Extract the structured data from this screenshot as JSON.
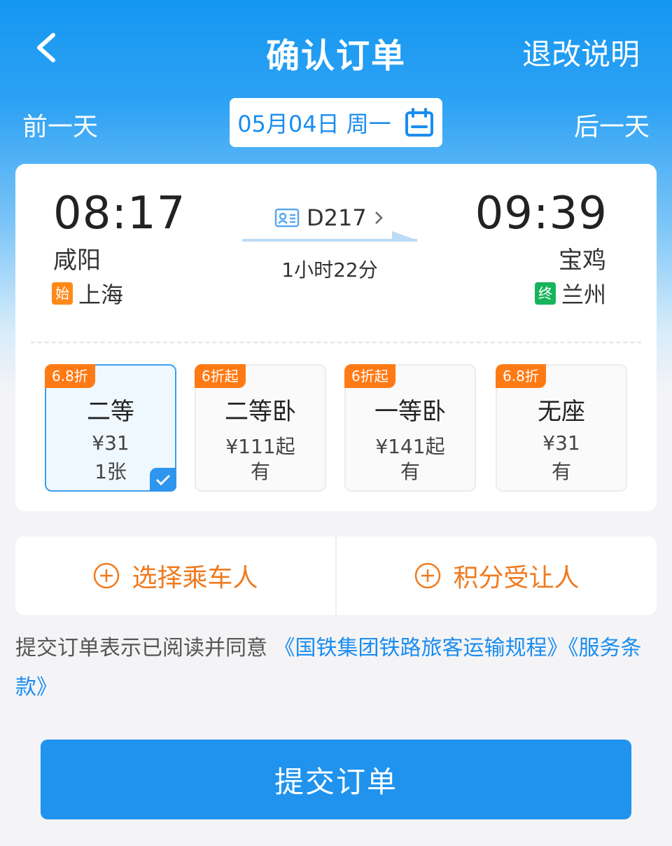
{
  "nav": {
    "title": "确认订单",
    "rule_label": "退改说明"
  },
  "date_bar": {
    "prev_label": "前一天",
    "next_label": "后一天",
    "date_text": "05月04日 周一"
  },
  "train": {
    "departure_time": "08:17",
    "departure_station": "咸阳",
    "origin_tag": "始",
    "origin_station": "上海",
    "arrival_time": "09:39",
    "arrival_station": "宝鸡",
    "terminal_tag": "终",
    "terminal_station": "兰州",
    "train_number": "D217",
    "duration": "1小时22分"
  },
  "seats": [
    {
      "badge": "6.8折",
      "name": "二等",
      "price": "¥31",
      "stock": "1张",
      "selected": true
    },
    {
      "badge": "6折起",
      "name": "二等卧",
      "price": "¥111起",
      "stock": "有",
      "selected": false
    },
    {
      "badge": "6折起",
      "name": "一等卧",
      "price": "¥141起",
      "stock": "有",
      "selected": false
    },
    {
      "badge": "6.8折",
      "name": "无座",
      "price": "¥31",
      "stock": "有",
      "selected": false
    }
  ],
  "passenger": {
    "select_label": "选择乘车人",
    "points_label": "积分受让人"
  },
  "agreement": {
    "prefix": "提交订单表示已阅读并同意 ",
    "link1": "《国铁集团铁路旅客运输规程》",
    "link2": "《服务条款》"
  },
  "submit_label": "提交订单",
  "colors": {
    "brand_blue": "#1f93ee",
    "accent_orange": "#f07a1e",
    "start_tag": "#ff8a1a",
    "end_tag": "#18b45c"
  }
}
